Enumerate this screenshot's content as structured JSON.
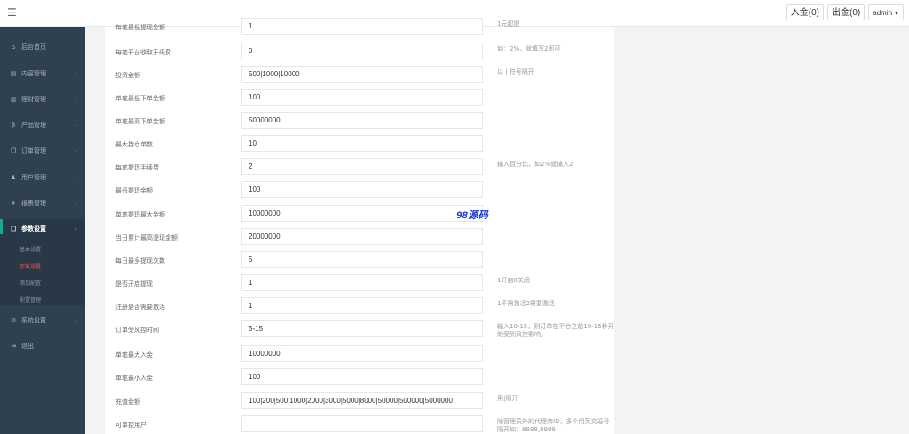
{
  "topbar": {
    "deposit": "入金(0)",
    "withdraw": "出金(0)",
    "user": "admin"
  },
  "sidebar": {
    "items": [
      {
        "label": "后台首页",
        "icon": "home-icon"
      },
      {
        "label": "内容管理",
        "icon": "file-icon"
      },
      {
        "label": "理财管理",
        "icon": "clipboard-icon"
      },
      {
        "label": "产品管理",
        "icon": "bitcoin-icon"
      },
      {
        "label": "订单管理",
        "icon": "copy-icon"
      },
      {
        "label": "用户管理",
        "icon": "user-icon"
      },
      {
        "label": "报表管理",
        "icon": "yen-icon"
      },
      {
        "label": "参数设置",
        "icon": "files-icon"
      },
      {
        "label": "系统设置",
        "icon": "gears-icon"
      },
      {
        "label": "退出",
        "icon": "sign-out-icon"
      }
    ],
    "sub_items": [
      "基本设置",
      "参数设置",
      "添加配置",
      "配置管理"
    ]
  },
  "form": {
    "rows": [
      {
        "label": "每笔最低提现金额",
        "value": "1",
        "help": "1元起提"
      },
      {
        "label": "每笔平台收取手续费",
        "value": "0",
        "help": "如：2%，就填写2即可"
      },
      {
        "label": "投资金额",
        "value": "500|1000|10000",
        "help": "以 | 符号隔开"
      },
      {
        "label": "单笔最低下单金额",
        "value": "100",
        "help": ""
      },
      {
        "label": "单笔最高下单金额",
        "value": "50000000",
        "help": ""
      },
      {
        "label": "最大持仓单数",
        "value": "10",
        "help": ""
      },
      {
        "label": "每笔提现手续费",
        "value": "2",
        "help": "输入百分比，如2%就输入2"
      },
      {
        "label": "最低提现金额",
        "value": "100",
        "help": ""
      },
      {
        "label": "单笔提现最大金额",
        "value": "10000000",
        "help": ""
      },
      {
        "label": "当日累计最高提现金额",
        "value": "20000000",
        "help": ""
      },
      {
        "label": "每日最多提现次数",
        "value": "5",
        "help": ""
      },
      {
        "label": "是否开启提现",
        "value": "1",
        "help": "1开启0关闭"
      },
      {
        "label": "注册是否需要激活",
        "value": "1",
        "help": "1不需激活2需要激活"
      },
      {
        "label": "订单受风控时间",
        "value": "5-15",
        "help": "输入10-15，则订单在平仓之前10-15秒开始受到风控影响。"
      },
      {
        "label": "单笔最大入金",
        "value": "10000000",
        "help": ""
      },
      {
        "label": "单笔最小入金",
        "value": "100",
        "help": ""
      },
      {
        "label": "充值金额",
        "value": "100|200|500|1000|2000|3000|5000|8000|50000|500000|5000000",
        "help": "用|隔开"
      },
      {
        "label": "可单控用户",
        "value": "",
        "help": "除管理员外的代理商ID，多个用英文逗号隔开如：8888,9999"
      }
    ]
  },
  "watermark": "98源码"
}
